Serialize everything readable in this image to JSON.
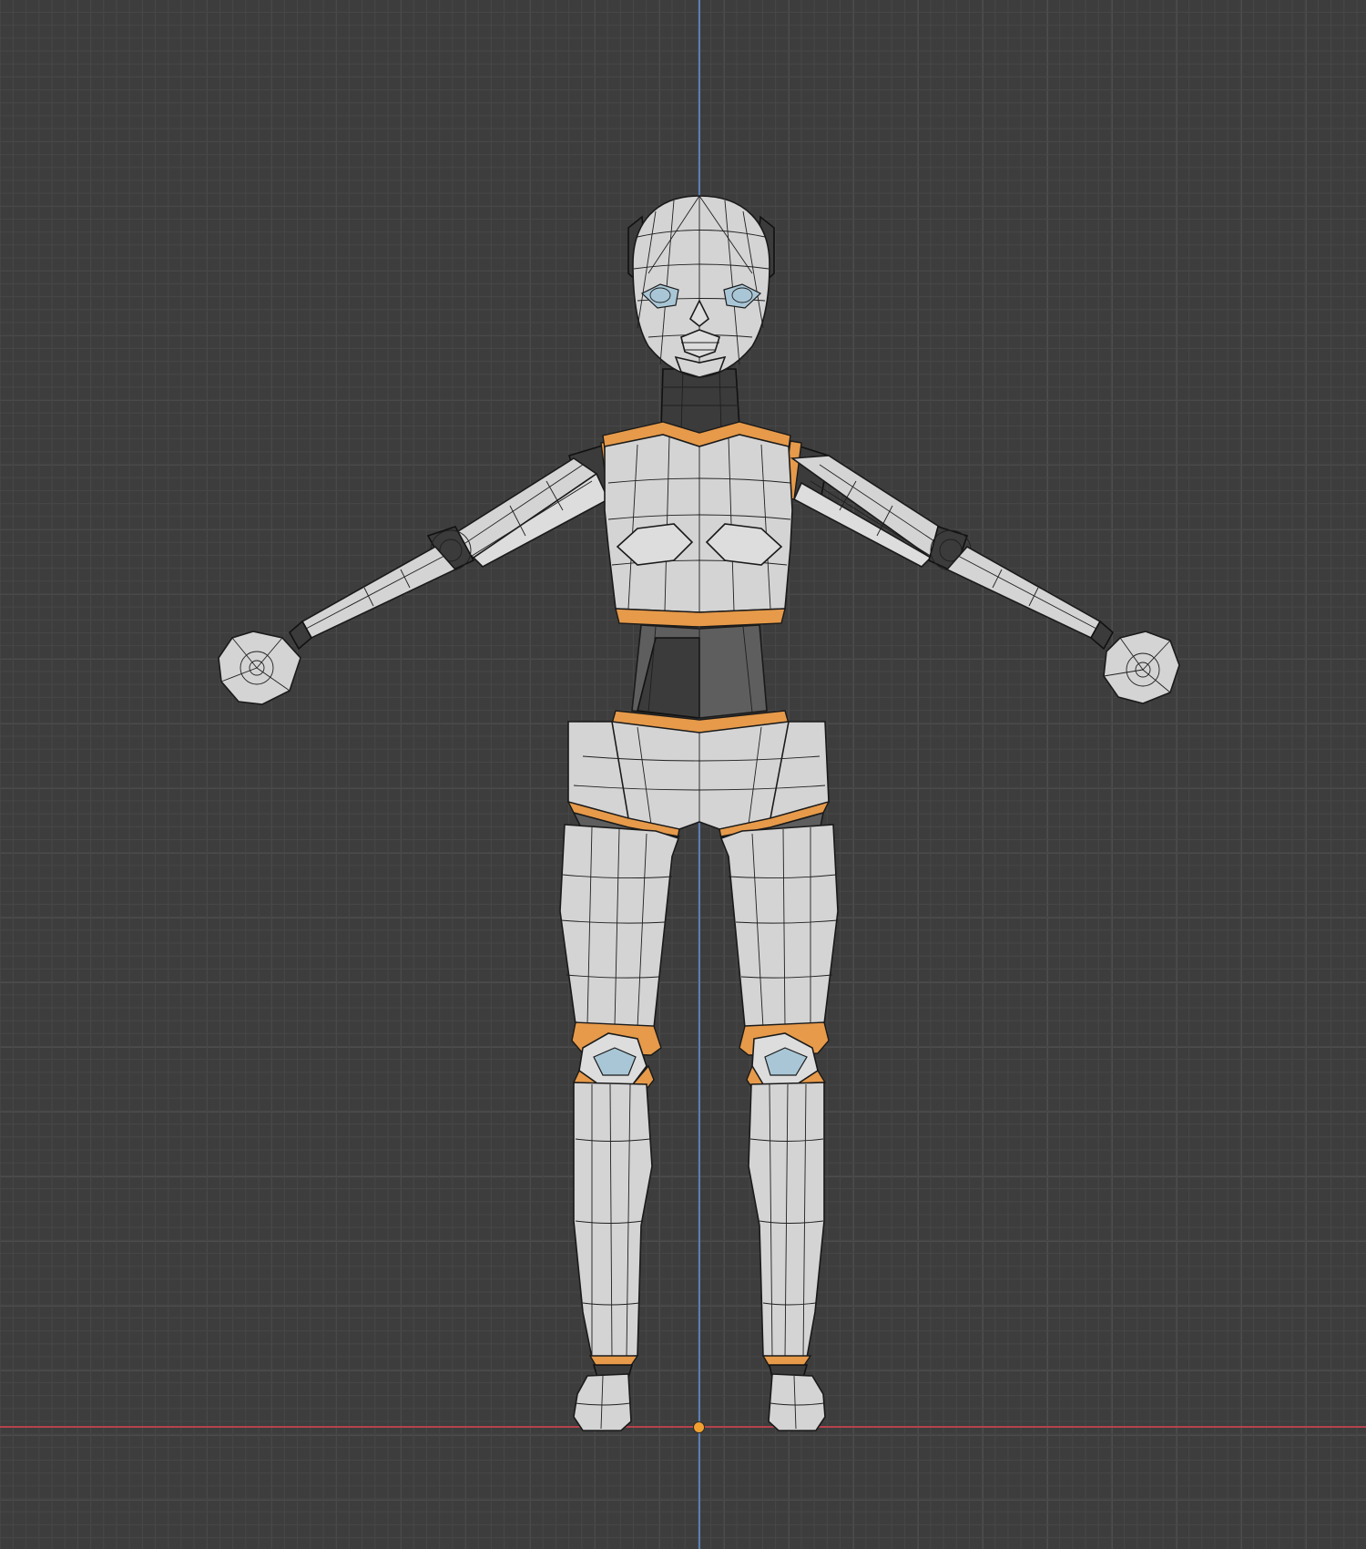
{
  "viewport": {
    "view": "front-orthographic",
    "shading": "solid-wireframe",
    "colors": {
      "background": "#3d3d3d",
      "grid": "#474747",
      "axis_z": "#5a7fb3",
      "axis_x": "#b3434c",
      "origin": "#f0a030",
      "mesh_fill": "#d4d4d4",
      "mesh_dark": "#5e5e5e",
      "selected_edge": "#e69a4a"
    }
  }
}
